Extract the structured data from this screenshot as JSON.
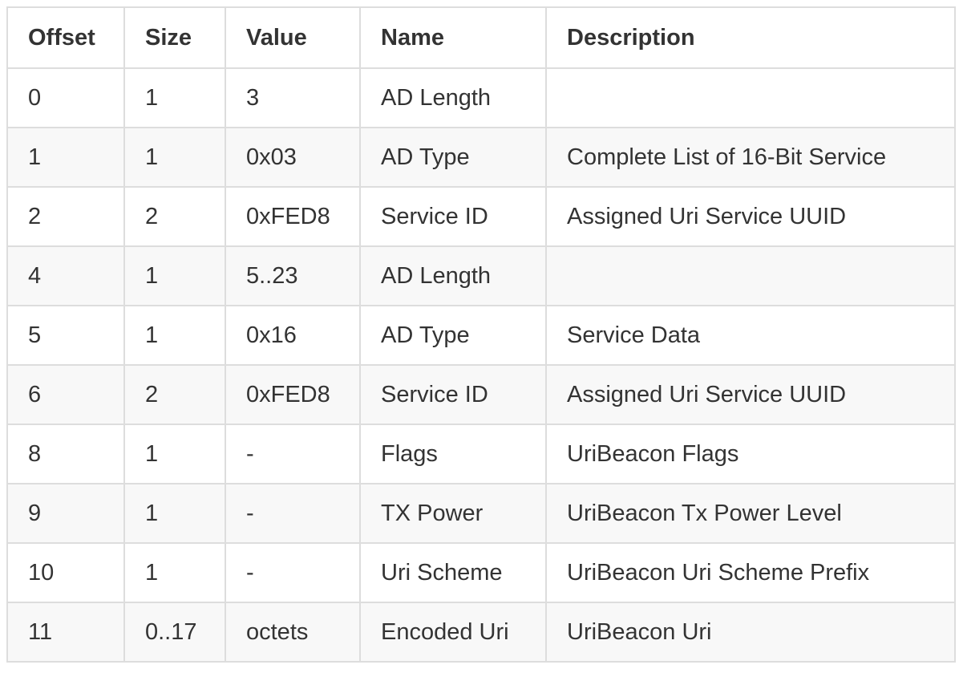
{
  "table": {
    "headers": [
      "Offset",
      "Size",
      "Value",
      "Name",
      "Description"
    ],
    "rows": [
      [
        "0",
        "1",
        "3",
        "AD Length",
        ""
      ],
      [
        "1",
        "1",
        "0x03",
        "AD Type",
        "Complete List of 16-Bit Service"
      ],
      [
        "2",
        "2",
        "0xFED8",
        "Service ID",
        "Assigned Uri Service UUID"
      ],
      [
        "4",
        "1",
        "5..23",
        "AD Length",
        ""
      ],
      [
        "5",
        "1",
        "0x16",
        "AD Type",
        "Service Data"
      ],
      [
        "6",
        "2",
        "0xFED8",
        "Service ID",
        "Assigned Uri Service UUID"
      ],
      [
        "8",
        "1",
        "-",
        "Flags",
        "UriBeacon Flags"
      ],
      [
        "9",
        "1",
        "-",
        "TX Power",
        "UriBeacon Tx Power Level"
      ],
      [
        "10",
        "1",
        "-",
        "Uri Scheme",
        "UriBeacon Uri Scheme Prefix"
      ],
      [
        "11",
        "0..17",
        "octets",
        "Encoded Uri",
        "UriBeacon Uri"
      ]
    ]
  }
}
